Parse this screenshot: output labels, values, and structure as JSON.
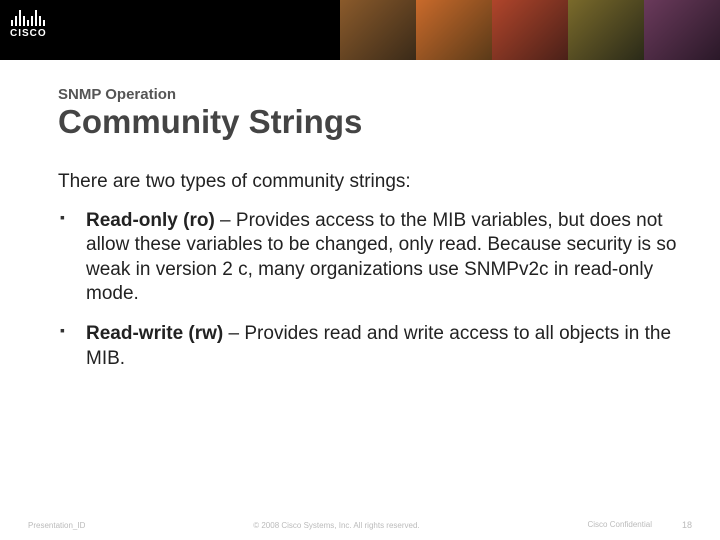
{
  "header": {
    "logo_text": "CISCO"
  },
  "content": {
    "eyebrow": "SNMP Operation",
    "title": "Community Strings",
    "intro": "There are two types of community strings:",
    "bullets": [
      {
        "lead": "Read-only (ro)",
        "body": " – Provides access to the MIB variables, but does not allow these variables to be changed, only read. Because security is so weak in version 2 c, many organizations use SNMPv2c in read-only mode."
      },
      {
        "lead": "Read-write (rw)",
        "body": " – Provides read and write access to all objects in the MIB."
      }
    ]
  },
  "footer": {
    "left": "Presentation_ID",
    "center": "© 2008 Cisco Systems, Inc. All rights reserved.",
    "right": "Cisco Confidential",
    "page": "18"
  }
}
